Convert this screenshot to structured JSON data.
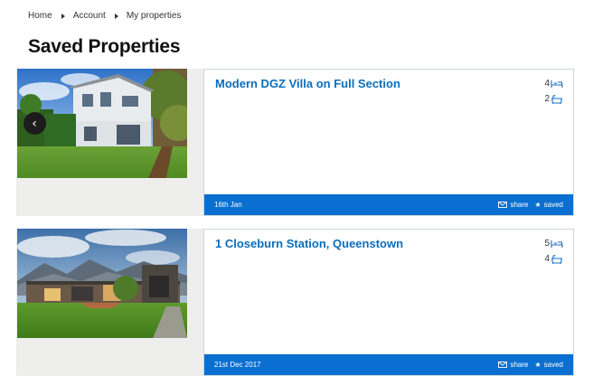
{
  "breadcrumb": {
    "home": "Home",
    "account": "Account",
    "current": "My properties"
  },
  "page_title": "Saved Properties",
  "colors": {
    "link_blue": "#0a6ebd",
    "footer_blue": "#0a6fd0",
    "card_bg": "#eeefec"
  },
  "properties": [
    {
      "title": "Modern DGZ Villa on Full Section",
      "beds": "4",
      "baths": "2",
      "date": "16th Jan",
      "share_label": "share",
      "saved_label": "saved",
      "photo": "white two-storey house with lawn",
      "icons": [
        "chevron-left-icon",
        "bed-icon",
        "bath-icon",
        "mail-icon",
        "star-icon"
      ]
    },
    {
      "title": "1 Closeburn Station, Queenstown",
      "beds": "5",
      "baths": "4",
      "date": "21st Dec 2017",
      "share_label": "share",
      "saved_label": "saved",
      "photo": "modern lodge with mountains and lawn",
      "icons": [
        "bed-icon",
        "bath-icon",
        "mail-icon",
        "star-icon"
      ]
    }
  ]
}
